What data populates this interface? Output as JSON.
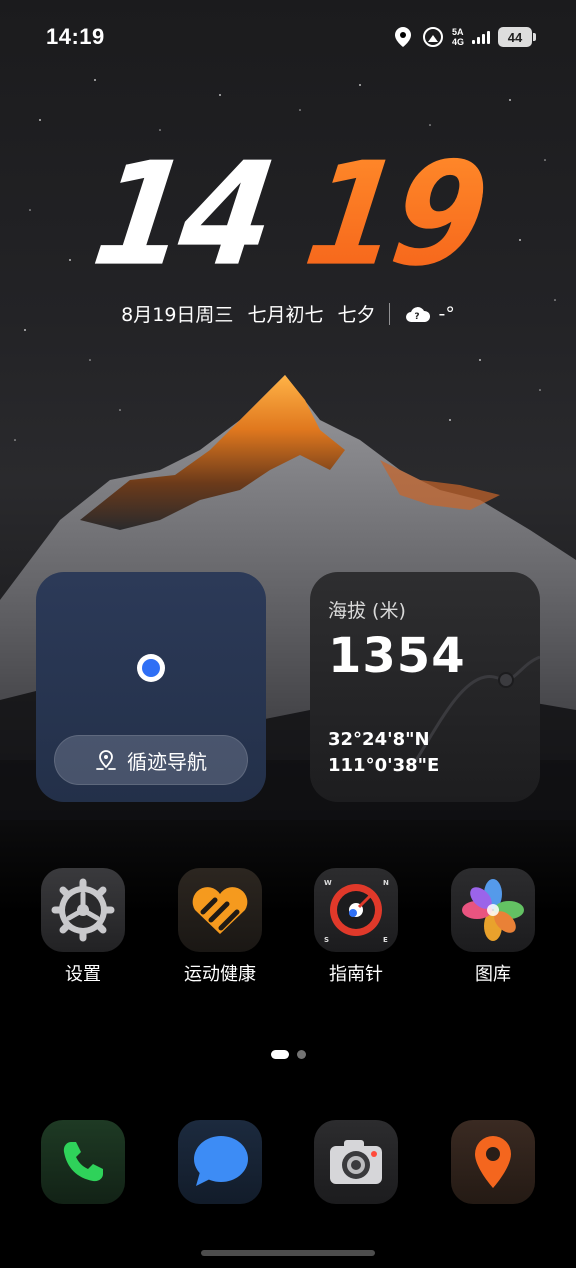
{
  "status_bar": {
    "time": "14:19",
    "network_top": "5A",
    "network_bottom": "4G",
    "battery": "44"
  },
  "lockclock": {
    "hour": "14",
    "minute": "19",
    "date": "8月19日周三",
    "lunar": "七月初七",
    "festival": "七夕",
    "weather": "-°",
    "minute_color": "#f5631a"
  },
  "widgets": {
    "navigation": {
      "button_label": "循迹导航",
      "dot_color": "#2f6ff5"
    },
    "altitude": {
      "label": "海拔 (米)",
      "value": "1354",
      "latitude": "32°24'8\"N",
      "longitude": "111°0'38\"E"
    }
  },
  "apps": [
    {
      "label": "设置",
      "icon": "settings-gear-icon"
    },
    {
      "label": "运动健康",
      "icon": "health-heart-icon"
    },
    {
      "label": "指南针",
      "icon": "compass-icon"
    },
    {
      "label": "图库",
      "icon": "gallery-flower-icon"
    }
  ],
  "dock": [
    {
      "icon": "phone-icon"
    },
    {
      "icon": "messages-icon"
    },
    {
      "icon": "camera-icon"
    },
    {
      "icon": "maps-pin-icon"
    }
  ],
  "page_indicator": {
    "current": 1,
    "total": 2
  }
}
